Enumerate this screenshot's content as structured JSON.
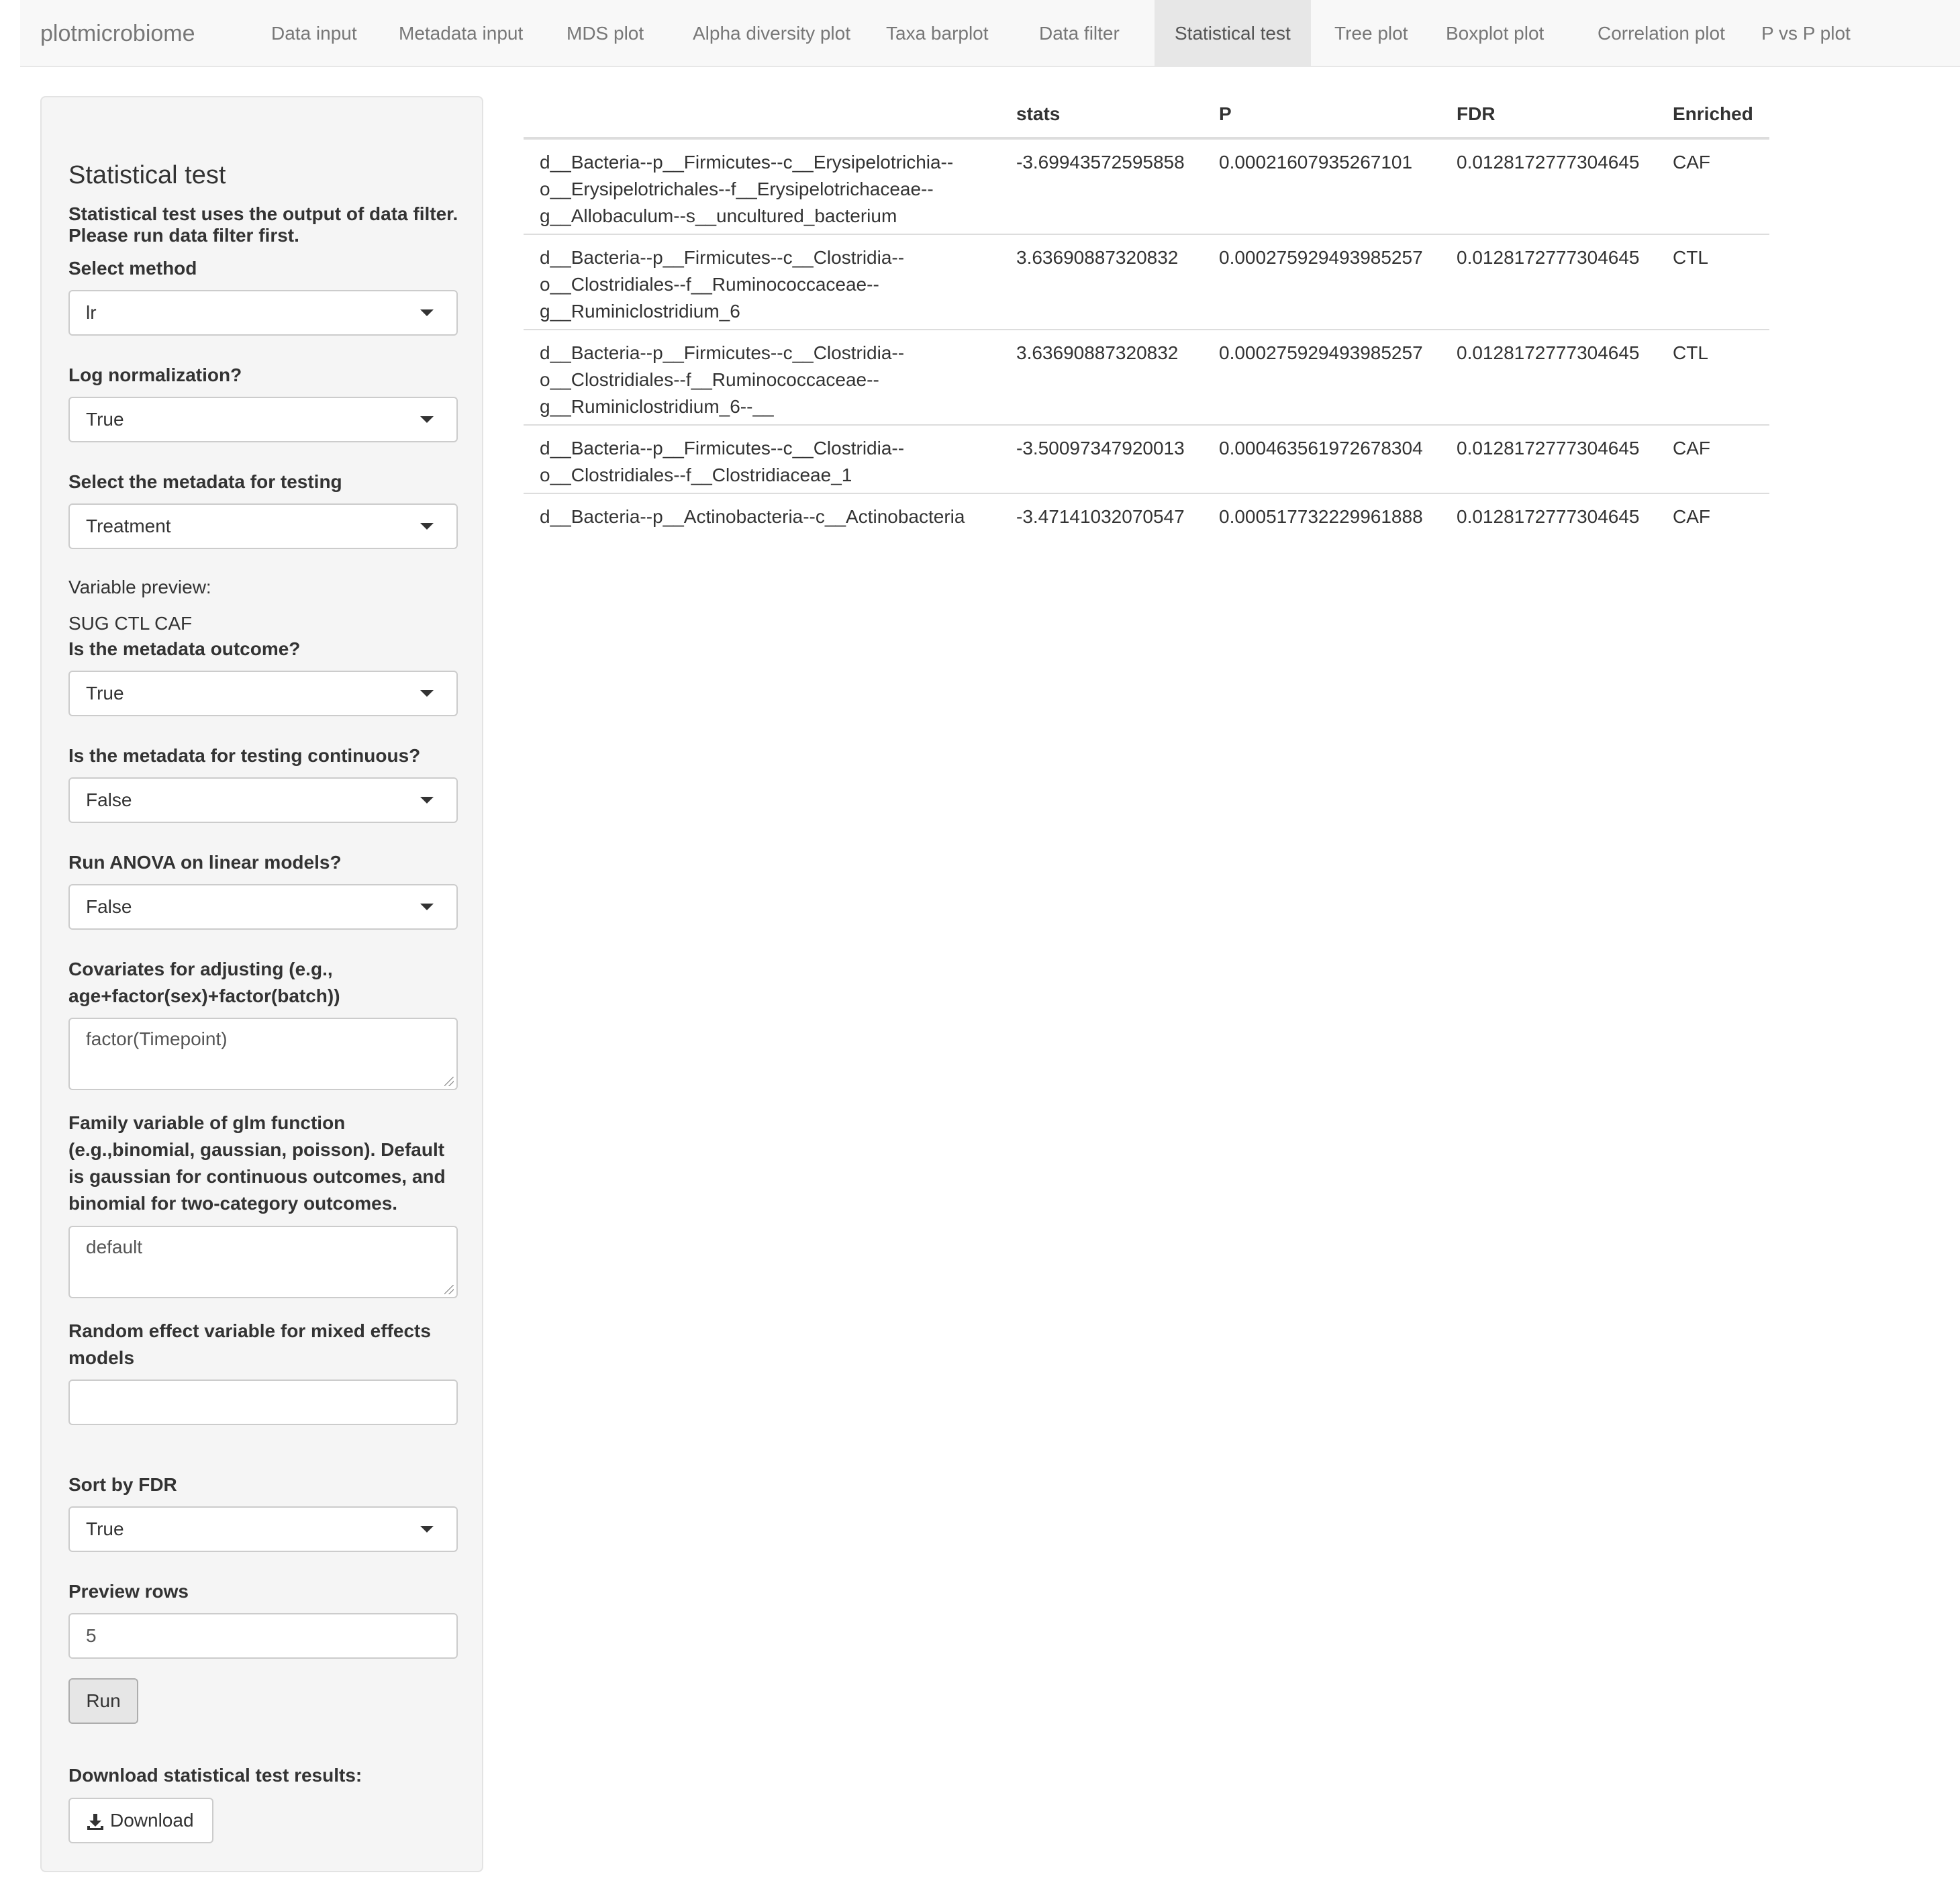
{
  "navbar": {
    "brand": "plotmicrobiome",
    "tabs": [
      {
        "label": "Data input"
      },
      {
        "label": "Metadata input"
      },
      {
        "label": "MDS plot"
      },
      {
        "label": "Alpha diversity plot"
      },
      {
        "label": "Taxa barplot"
      },
      {
        "label": "Data filter"
      },
      {
        "label": "Statistical test"
      },
      {
        "label": "Tree plot"
      },
      {
        "label": "Boxplot plot"
      },
      {
        "label": "Correlation plot"
      },
      {
        "label": "P vs P plot"
      }
    ],
    "active_tab": "Statistical test"
  },
  "sidebar": {
    "title": "Statistical test",
    "description": "Statistical test uses the output of data filter. Please run data filter first.",
    "method": {
      "label": "Select method",
      "value": "lr"
    },
    "log_norm": {
      "label": "Log normalization?",
      "value": "True"
    },
    "metadata": {
      "label": "Select the metadata for testing",
      "value": "Treatment"
    },
    "variable_preview": {
      "label": "Variable preview:",
      "value": "SUG CTL CAF"
    },
    "outcome": {
      "label": "Is the metadata outcome?",
      "value": "True"
    },
    "continuous": {
      "label": "Is the metadata for testing continuous?",
      "value": "False"
    },
    "anova": {
      "label": "Run ANOVA on linear models?",
      "value": "False"
    },
    "covariates": {
      "label": "Covariates for adjusting (e.g., age+factor(sex)+factor(batch))",
      "value": "factor(Timepoint)"
    },
    "family": {
      "label": "Family variable of glm function (e.g.,binomial, gaussian, poisson). Default is gaussian for continuous outcomes, and binomial for two-category outcomes.",
      "value": "default"
    },
    "random_effect": {
      "label": "Random effect variable for mixed effects models",
      "value": ""
    },
    "sort_fdr": {
      "label": "Sort by FDR",
      "value": "True"
    },
    "preview_rows": {
      "label": "Preview rows",
      "value": "5"
    },
    "run_label": "Run",
    "download": {
      "label": "Download statistical test results:",
      "button": "Download",
      "icon": "download-icon"
    }
  },
  "results": {
    "columns": [
      "",
      "stats",
      "P",
      "FDR",
      "Enriched"
    ],
    "rows": [
      {
        "name_lines": [
          "d__Bacteria--p__Firmicutes--c__Erysipelotrichia--",
          "o__Erysipelotrichales--f__Erysipelotrichaceae--",
          "g__Allobaculum--s__uncultured_bacterium"
        ],
        "stats": "-3.69943572595858",
        "p": "0.00021607935267101",
        "fdr": "0.0128172777304645",
        "enriched": "CAF"
      },
      {
        "name_lines": [
          "d__Bacteria--p__Firmicutes--c__Clostridia--",
          "o__Clostridiales--f__Ruminococcaceae--",
          "g__Ruminiclostridium_6"
        ],
        "stats": "3.63690887320832",
        "p": "0.000275929493985257",
        "fdr": "0.0128172777304645",
        "enriched": "CTL"
      },
      {
        "name_lines": [
          "d__Bacteria--p__Firmicutes--c__Clostridia--",
          "o__Clostridiales--f__Ruminococcaceae--",
          "g__Ruminiclostridium_6--__"
        ],
        "stats": "3.63690887320832",
        "p": "0.000275929493985257",
        "fdr": "0.0128172777304645",
        "enriched": "CTL"
      },
      {
        "name_lines": [
          "d__Bacteria--p__Firmicutes--c__Clostridia--",
          "o__Clostridiales--f__Clostridiaceae_1",
          ""
        ],
        "stats": "-3.50097347920013",
        "p": "0.000463561972678304",
        "fdr": "0.0128172777304645",
        "enriched": "CAF"
      },
      {
        "name_lines": [
          "d__Bacteria--p__Actinobacteria--c__Actinobacteria",
          "",
          ""
        ],
        "stats": "-3.47141032070547",
        "p": "0.000517732229961888",
        "fdr": "0.0128172777304645",
        "enriched": "CAF"
      }
    ]
  }
}
